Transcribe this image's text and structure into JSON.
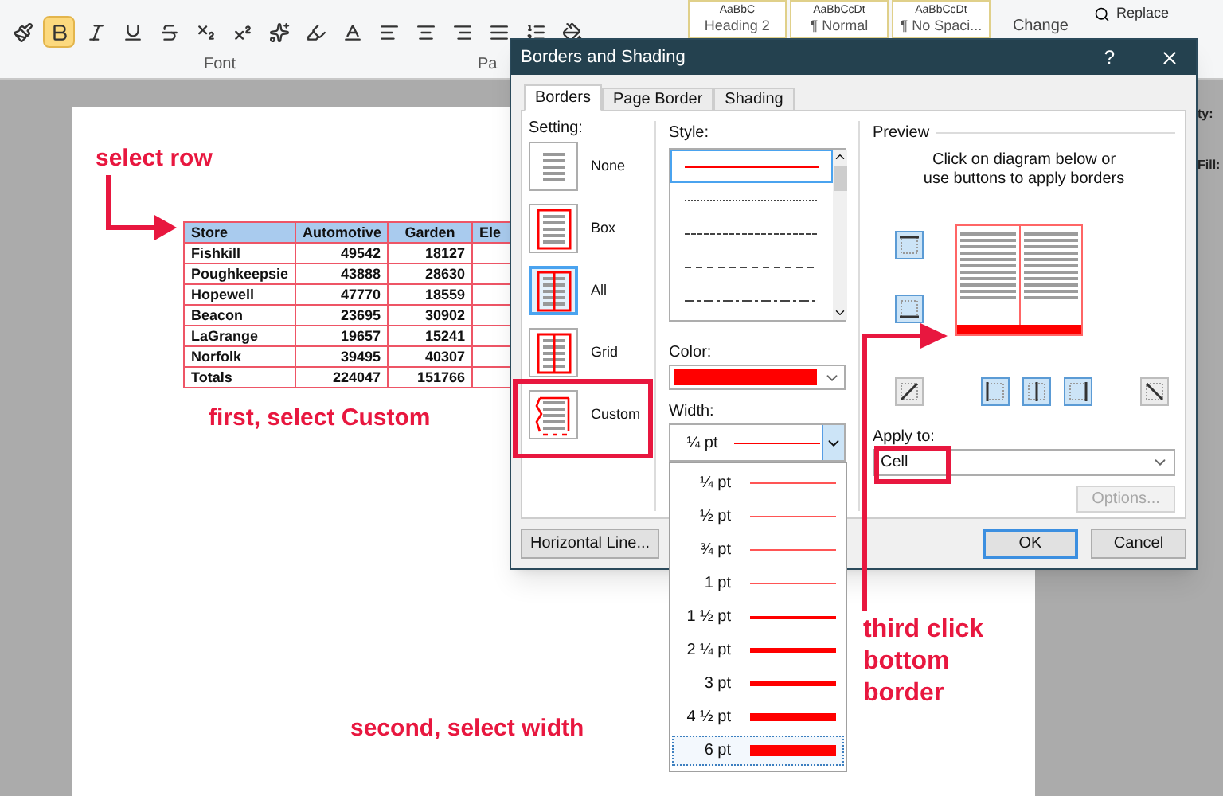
{
  "ribbon": {
    "format_buttons": [
      {
        "kind": "paste-format",
        "selected": false
      },
      {
        "kind": "bold",
        "selected": true
      },
      {
        "kind": "italic",
        "selected": false
      },
      {
        "kind": "underline",
        "selected": false
      },
      {
        "kind": "strikethrough",
        "selected": false
      },
      {
        "kind": "subscript",
        "selected": false
      },
      {
        "kind": "superscript",
        "selected": false
      },
      {
        "kind": "text-effects",
        "selected": false
      },
      {
        "kind": "highlight",
        "selected": false
      },
      {
        "kind": "font-color",
        "selected": false
      },
      {
        "kind": "align-left",
        "selected": false
      },
      {
        "kind": "align-center",
        "selected": false
      },
      {
        "kind": "align-right",
        "selected": false
      },
      {
        "kind": "justify",
        "selected": false
      },
      {
        "kind": "line-spacing",
        "selected": false
      },
      {
        "kind": "shading",
        "selected": false
      }
    ],
    "group_labels": [
      "Font",
      "Pa"
    ],
    "styles": [
      {
        "preview": "AaBbC",
        "name": "Heading 2"
      },
      {
        "preview": "AaBbCcDt",
        "name": "¶ Normal"
      },
      {
        "preview": "AaBbCcDt",
        "name": "¶ No Spaci..."
      }
    ],
    "change_styles": "Change",
    "replace": "Replace",
    "side_labels": [
      "ty:",
      "Fill:"
    ]
  },
  "table": {
    "columns": [
      "Store",
      "Automotive",
      "Garden",
      "Ele"
    ],
    "header_selected": true,
    "rows": [
      [
        "Fishkill",
        "49542",
        "18127"
      ],
      [
        "Poughkeepsie",
        "43888",
        "28630"
      ],
      [
        "Hopewell",
        "47770",
        "18559"
      ],
      [
        "Beacon",
        "23695",
        "30902"
      ],
      [
        "LaGrange",
        "19657",
        "15241"
      ],
      [
        "Norfolk",
        "39495",
        "40307"
      ],
      [
        "Totals",
        "224047",
        "151766"
      ]
    ]
  },
  "dialog": {
    "title": "Borders and Shading",
    "help": "?",
    "tabs": [
      {
        "label": "Borders",
        "selected": true
      },
      {
        "label": "Page Border",
        "selected": false
      },
      {
        "label": "Shading",
        "selected": false
      }
    ],
    "setting_label": "Setting:",
    "settings": [
      {
        "label": "None",
        "kind": "none",
        "selected": false
      },
      {
        "label": "Box",
        "kind": "box",
        "selected": false
      },
      {
        "label": "All",
        "kind": "all",
        "selected": true
      },
      {
        "label": "Grid",
        "kind": "grid",
        "selected": false
      },
      {
        "label": "Custom",
        "kind": "custom",
        "selected": false
      }
    ],
    "style_label": "Style:",
    "styles": [
      {
        "kind": "solid",
        "selected": true
      },
      {
        "kind": "dotted",
        "selected": false
      },
      {
        "kind": "dashed-fine",
        "selected": false
      },
      {
        "kind": "dashed",
        "selected": false
      },
      {
        "kind": "dash-dot",
        "selected": false
      }
    ],
    "color_label": "Color:",
    "color": "#ff0000",
    "width_label": "Width:",
    "width_value": "¼ pt",
    "width_options": [
      {
        "label": "¼ pt",
        "selected": false
      },
      {
        "label": "½ pt",
        "selected": false
      },
      {
        "label": "¾ pt",
        "selected": false
      },
      {
        "label": "1 pt",
        "selected": false
      },
      {
        "label": "1 ½ pt",
        "selected": false
      },
      {
        "label": "2 ¼ pt",
        "selected": false
      },
      {
        "label": "3 pt",
        "selected": false
      },
      {
        "label": "4 ½ pt",
        "selected": false
      },
      {
        "label": "6 pt",
        "selected": true
      }
    ],
    "preview_label": "Preview",
    "preview_hint": "Click on diagram below or use buttons to apply borders",
    "preview_buttons": [
      {
        "kind": "top",
        "selected": true
      },
      {
        "kind": "bottom",
        "selected": true
      },
      {
        "kind": "diagonal-up",
        "selected": false
      },
      {
        "kind": "left",
        "selected": true
      },
      {
        "kind": "inside-vertical",
        "selected": true
      },
      {
        "kind": "right",
        "selected": true
      },
      {
        "kind": "diagonal-down",
        "selected": false
      }
    ],
    "apply_to_label": "Apply to:",
    "apply_to": "Cell",
    "options": {
      "label": "Options...",
      "disabled": true
    },
    "horizontal_line": "Horizontal Line...",
    "ok": "OK",
    "cancel": "Cancel"
  },
  "annotations": [
    "select row",
    "first, select Custom",
    "second, select width",
    "third click bottom border"
  ]
}
